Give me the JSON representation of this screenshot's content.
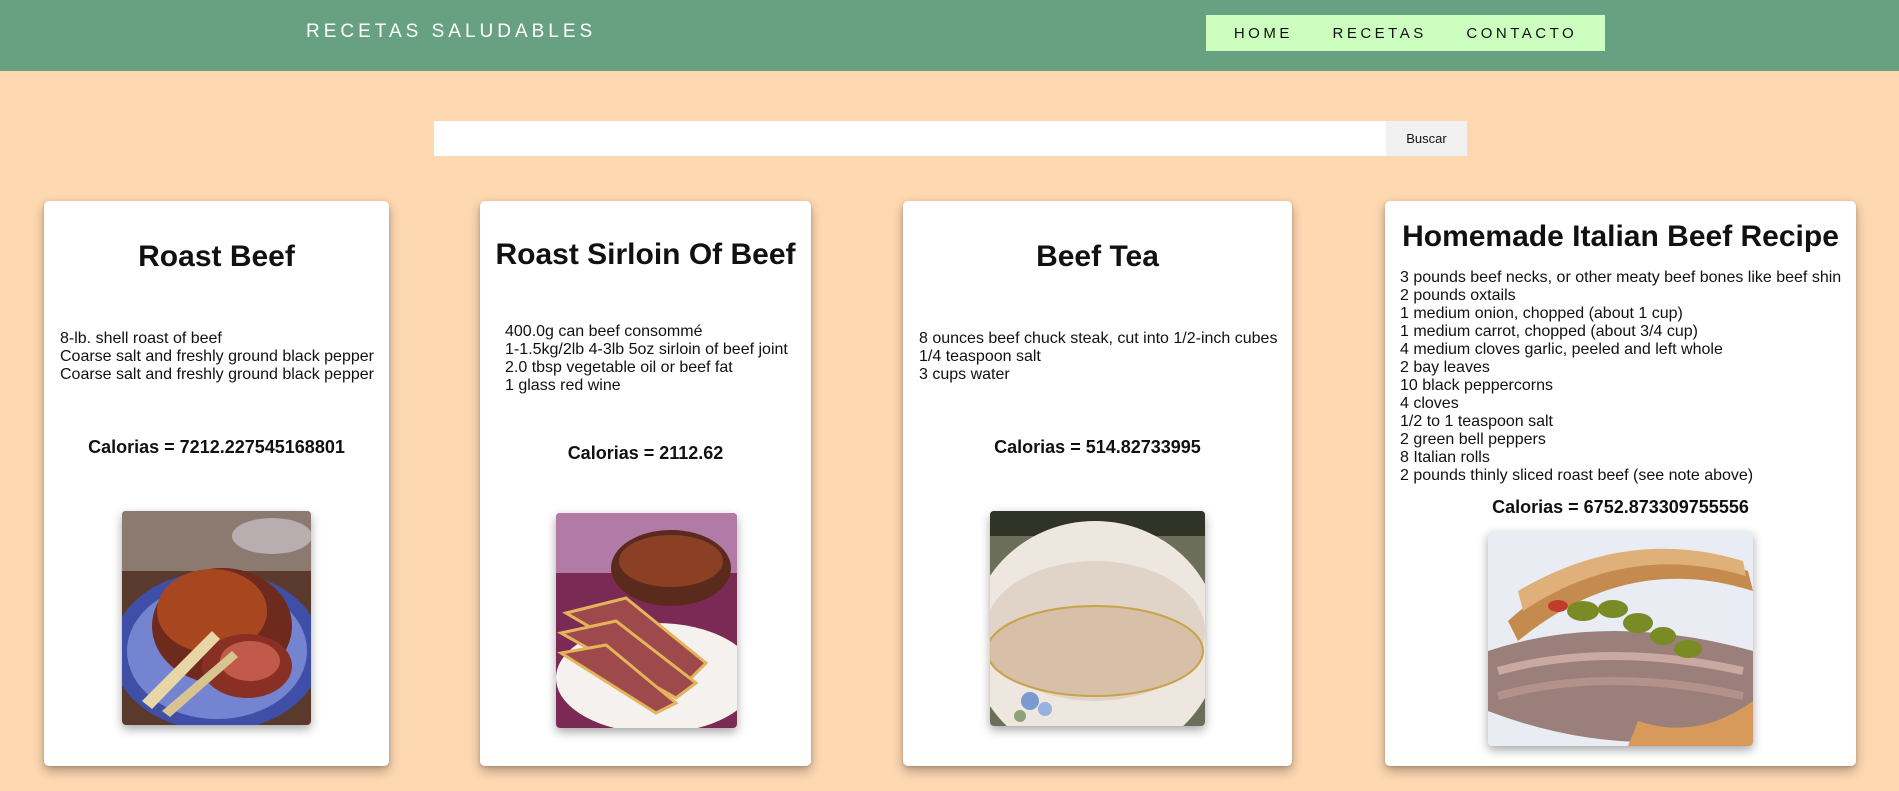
{
  "header": {
    "brand": "RECETAS SALUDABLES",
    "nav": [
      "HOME",
      "RECETAS",
      "CONTACTO"
    ]
  },
  "search": {
    "value": "",
    "placeholder": "",
    "button_label": "Buscar"
  },
  "recipes": [
    {
      "title": "Roast Beef",
      "ingredients": [
        "8-lb. shell roast of beef",
        "Coarse salt and freshly ground black pepper",
        "Coarse salt and freshly ground black pepper"
      ],
      "calories": "Calorias = 7212.227545168801"
    },
    {
      "title": "Roast Sirloin Of Beef",
      "ingredients": [
        "400.0g can beef consommé",
        "1-1.5kg/2lb 4-3lb 5oz sirloin of beef joint",
        "2.0 tbsp vegetable oil or beef fat",
        "1 glass red wine"
      ],
      "calories": "Calorias = 2112.62"
    },
    {
      "title": "Beef Tea",
      "ingredients": [
        "8 ounces beef chuck steak, cut into 1/2-inch cubes",
        "1/4 teaspoon salt",
        "3 cups water"
      ],
      "calories": "Calorias = 514.82733995"
    },
    {
      "title": "Homemade Italian Beef Recipe",
      "ingredients": [
        "3 pounds beef necks, or other meaty beef bones like beef shin",
        "2 pounds oxtails",
        "1 medium onion, chopped (about 1 cup)",
        "1 medium carrot, chopped (about 3/4 cup)",
        "4 medium cloves garlic, peeled and left whole",
        "2 bay leaves",
        "10 black peppercorns",
        "4 cloves",
        "1/2 to 1 teaspoon salt",
        "2 green bell peppers",
        "8 Italian rolls",
        "2 pounds thinly sliced roast beef (see note above)"
      ],
      "calories": "Calorias = 6752.873309755556"
    }
  ],
  "colors": {
    "background": "#fed8b1",
    "header": "#68a182",
    "nav": "#ccffbf",
    "card": "#ffffff"
  }
}
